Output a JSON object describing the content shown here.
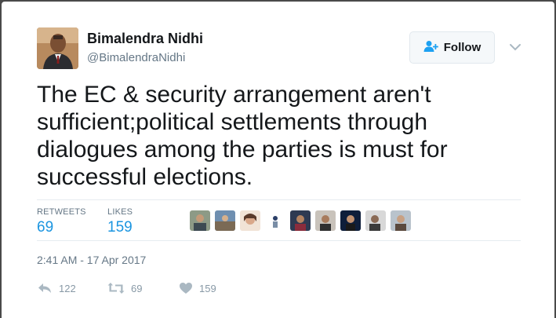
{
  "user": {
    "name": "Bimalendra Nidhi",
    "handle": "@BimalendraNidhi"
  },
  "follow": {
    "label": "Follow"
  },
  "tweet": {
    "lines": [
      "The EC & security arrangement aren't",
      "sufficient;political settlements through",
      "dialogues among the parties is must for",
      "successful elections."
    ]
  },
  "stats": {
    "retweets_label": "RETWEETS",
    "retweets_value": "69",
    "likes_label": "LIKES",
    "likes_value": "159"
  },
  "timestamp": "2:41 AM - 17 Apr 2017",
  "actions": {
    "reply_count": "122",
    "retweet_count": "69",
    "like_count": "159"
  },
  "colors": {
    "link_blue": "#1b95e0",
    "secondary_gray": "#657786",
    "action_gray": "#8899a6"
  },
  "icons": [
    "person-add-icon",
    "chevron-down-icon",
    "reply-icon",
    "retweet-icon",
    "heart-icon"
  ]
}
